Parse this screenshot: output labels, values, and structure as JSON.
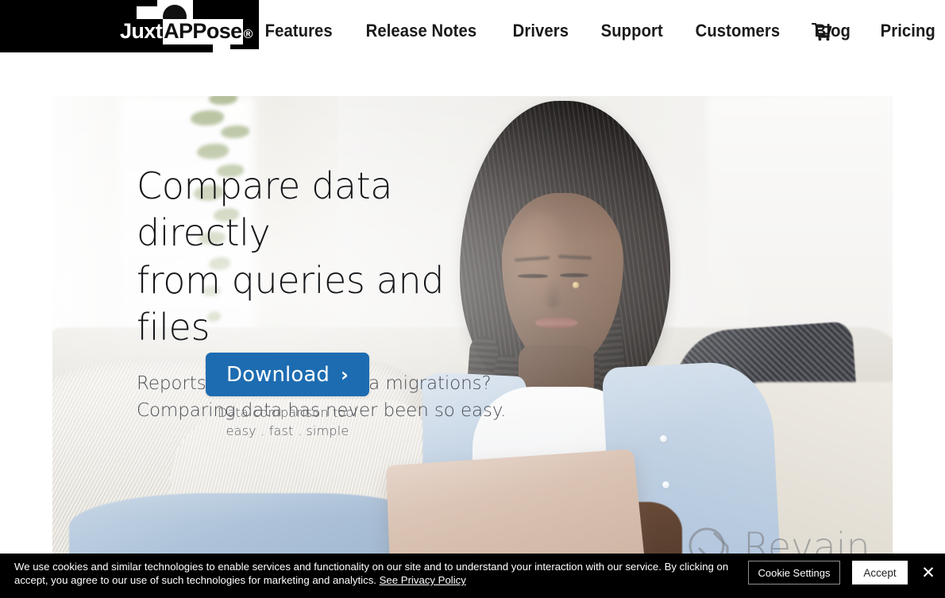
{
  "brand": {
    "name_part1": "Juxt",
    "name_part2": "APPose",
    "name_part3": "®",
    "logo_square": "white-square-mark",
    "logo_circle": "black-circle-mark",
    "accent_color": "#1d6cb1",
    "logo_bg": "#000000"
  },
  "nav": {
    "items": [
      {
        "label": "Features"
      },
      {
        "label": "Release Notes"
      },
      {
        "label": "Drivers"
      },
      {
        "label": "Support"
      },
      {
        "label": "Customers"
      },
      {
        "label": "Blog"
      },
      {
        "label": "Pricing"
      }
    ],
    "cart_icon": "shopping-cart-icon"
  },
  "hero": {
    "headline_line1": "Compare data directly",
    "headline_line2": "from queries and files",
    "sub_line1": "Reports don't match? Data migrations?",
    "sub_line2": "Comparing data has never been so easy.",
    "cta_label": "Download",
    "cta_chevron": "›",
    "caption_line1": "Data comparison tool",
    "caption_line2": "easy . fast . simple",
    "image_alt": "woman-with-laptop-on-sofa"
  },
  "watermark": {
    "text": "Revain",
    "mark": "revain-logo-mark"
  },
  "cookie": {
    "message_part1": "We use cookies and similar technologies to enable services and functionality on our site and to understand your interaction with our service. By clicking on accept, you agree to our use of such technologies for marketing and analytics.",
    "privacy_link": "See Privacy Policy",
    "settings_label": "Cookie Settings",
    "accept_label": "Accept",
    "close_icon": "✕",
    "background": "#000000"
  }
}
